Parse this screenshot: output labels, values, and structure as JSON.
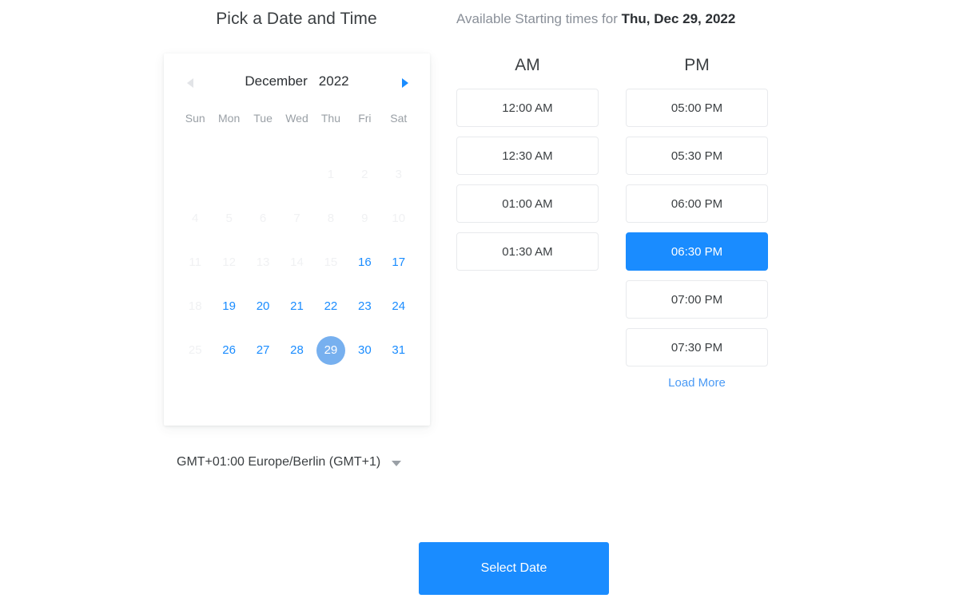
{
  "left_title": "Pick a Date and Time",
  "right_header": {
    "prefix": "Available Starting times for ",
    "date": "Thu, Dec 29, 2022"
  },
  "calendar": {
    "prev_icon": "triangle-left-icon",
    "next_icon": "triangle-right-icon",
    "month": "December",
    "year": "2022",
    "weekdays": [
      "Sun",
      "Mon",
      "Tue",
      "Wed",
      "Thu",
      "Fri",
      "Sat"
    ],
    "weeks": [
      [
        {
          "label": "",
          "state": "blank"
        },
        {
          "label": "",
          "state": "blank"
        },
        {
          "label": "",
          "state": "blank"
        },
        {
          "label": "",
          "state": "blank"
        },
        {
          "label": "1",
          "state": "disabled"
        },
        {
          "label": "2",
          "state": "disabled"
        },
        {
          "label": "3",
          "state": "disabled"
        }
      ],
      [
        {
          "label": "4",
          "state": "disabled"
        },
        {
          "label": "5",
          "state": "disabled"
        },
        {
          "label": "6",
          "state": "disabled"
        },
        {
          "label": "7",
          "state": "disabled"
        },
        {
          "label": "8",
          "state": "disabled"
        },
        {
          "label": "9",
          "state": "disabled"
        },
        {
          "label": "10",
          "state": "disabled"
        }
      ],
      [
        {
          "label": "11",
          "state": "disabled"
        },
        {
          "label": "12",
          "state": "disabled"
        },
        {
          "label": "13",
          "state": "disabled"
        },
        {
          "label": "14",
          "state": "disabled"
        },
        {
          "label": "15",
          "state": "disabled"
        },
        {
          "label": "16",
          "state": "enabled"
        },
        {
          "label": "17",
          "state": "enabled"
        }
      ],
      [
        {
          "label": "18",
          "state": "disabled"
        },
        {
          "label": "19",
          "state": "enabled"
        },
        {
          "label": "20",
          "state": "enabled"
        },
        {
          "label": "21",
          "state": "enabled"
        },
        {
          "label": "22",
          "state": "enabled"
        },
        {
          "label": "23",
          "state": "enabled"
        },
        {
          "label": "24",
          "state": "enabled"
        }
      ],
      [
        {
          "label": "25",
          "state": "disabled"
        },
        {
          "label": "26",
          "state": "enabled"
        },
        {
          "label": "27",
          "state": "enabled"
        },
        {
          "label": "28",
          "state": "enabled"
        },
        {
          "label": "29",
          "state": "selected"
        },
        {
          "label": "30",
          "state": "enabled"
        },
        {
          "label": "31",
          "state": "enabled"
        }
      ]
    ]
  },
  "timezone": {
    "value": "GMT+01:00 Europe/Berlin (GMT+1)",
    "caret_icon": "chevron-down-icon"
  },
  "time_columns": [
    {
      "title": "AM",
      "slots": [
        {
          "label": "12:00 AM",
          "selected": false
        },
        {
          "label": "12:30 AM",
          "selected": false
        },
        {
          "label": "01:00 AM",
          "selected": false
        },
        {
          "label": "01:30 AM",
          "selected": false
        }
      ],
      "load_more": ""
    },
    {
      "title": "PM",
      "slots": [
        {
          "label": "05:00 PM",
          "selected": false
        },
        {
          "label": "05:30 PM",
          "selected": false
        },
        {
          "label": "06:00 PM",
          "selected": false
        },
        {
          "label": "06:30 PM",
          "selected": true
        },
        {
          "label": "07:00 PM",
          "selected": false
        },
        {
          "label": "07:30 PM",
          "selected": false
        }
      ],
      "load_more": "Load More"
    }
  ],
  "footer": {
    "select_date_label": "Select Date"
  },
  "colors": {
    "accent_blue": "#1a8cff",
    "selected_day_blue": "#77b0ef",
    "link_blue": "#4a9af5",
    "disabled_gray": "#f0f1f3",
    "muted_text": "#9aa0a6",
    "text": "#3c4043",
    "border": "#e8eaed",
    "background": "#ffffff"
  }
}
